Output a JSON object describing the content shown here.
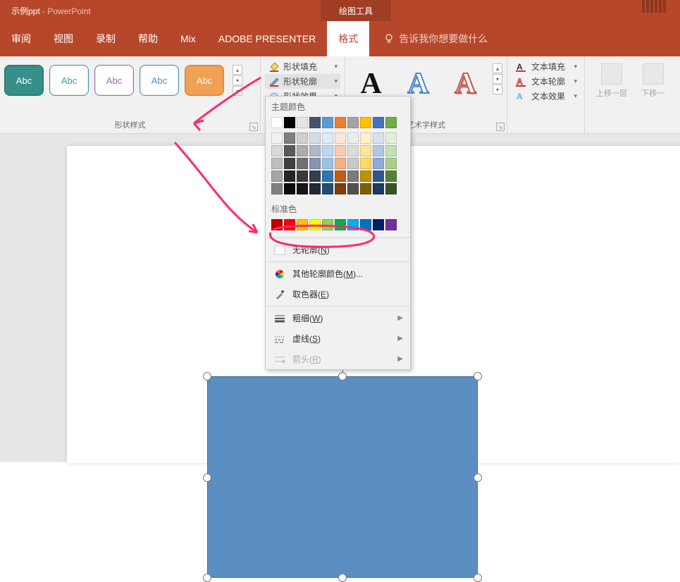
{
  "titlebar": {
    "filename": "示例ppt",
    "sep": " - ",
    "app": "PowerPoint",
    "contextual": "绘图工具"
  },
  "tabs": {
    "review": "审阅",
    "view": "视图",
    "record": "录制",
    "help": "帮助",
    "mix": "Mix",
    "adobe": "ADOBE PRESENTER",
    "format": "格式",
    "tellme": "告诉我你想要做什么"
  },
  "ribbon": {
    "shape_styles_label": "形状样式",
    "sample_text": "Abc",
    "fill": "形状填充",
    "outline": "形状轮廓",
    "effect": "形状效果",
    "wordart_label": "艺术字样式",
    "wa_letter": "A",
    "text_fill": "文本填充",
    "text_outline": "文本轮廓",
    "text_effect": "文本效果",
    "bring_forward": "上移一层",
    "send_backward": "下移一"
  },
  "dropdown": {
    "theme_colors_label": "主题颜色",
    "standard_colors_label": "标准色",
    "no_outline": "无轮廓(",
    "no_outline_key": "N",
    "no_outline_close": ")",
    "more_colors": "其他轮廓颜色(",
    "more_colors_key": "M",
    "more_colors_close": ")...",
    "eyedrop": "取色器(",
    "eyedrop_key": "E",
    "eyedrop_close": ")",
    "weight": "粗细(",
    "weight_key": "W",
    "weight_close": ")",
    "dashes": "虚线(",
    "dashes_key": "S",
    "dashes_close": ")",
    "arrows": "箭头(",
    "arrows_key": "R",
    "arrows_close": ")",
    "theme_row0": [
      "#ffffff",
      "#000000",
      "#e7e6e6",
      "#44546a",
      "#5b9bd5",
      "#ed7d31",
      "#a5a5a5",
      "#ffc000",
      "#4472c4",
      "#70ad47"
    ],
    "theme_shades": [
      [
        "#f2f2f2",
        "#7f7f7f",
        "#d0cece",
        "#d6dce4",
        "#deebf6",
        "#fbe5d5",
        "#ededed",
        "#fff2cc",
        "#d9e2f3",
        "#e2efd9"
      ],
      [
        "#d8d8d8",
        "#595959",
        "#aeabab",
        "#adb9ca",
        "#bdd7ee",
        "#f7cbac",
        "#dbdbdb",
        "#fee599",
        "#b4c6e7",
        "#c5e0b3"
      ],
      [
        "#bfbfbf",
        "#3f3f3f",
        "#757070",
        "#8496b0",
        "#9cc3e5",
        "#f4b183",
        "#c9c9c9",
        "#ffd965",
        "#8eaadb",
        "#a8d08d"
      ],
      [
        "#a5a5a5",
        "#262626",
        "#3a3838",
        "#323f4f",
        "#2e75b5",
        "#c55a11",
        "#7b7b7b",
        "#bf9000",
        "#2f5496",
        "#538135"
      ],
      [
        "#7f7f7f",
        "#0c0c0c",
        "#171616",
        "#222a35",
        "#1e4e79",
        "#833c0b",
        "#525252",
        "#7f6000",
        "#1f3864",
        "#375623"
      ]
    ],
    "standard": [
      "#c00000",
      "#ff0000",
      "#ffc000",
      "#ffff00",
      "#92d050",
      "#00b050",
      "#00b0f0",
      "#0070c0",
      "#002060",
      "#7030a0"
    ]
  }
}
